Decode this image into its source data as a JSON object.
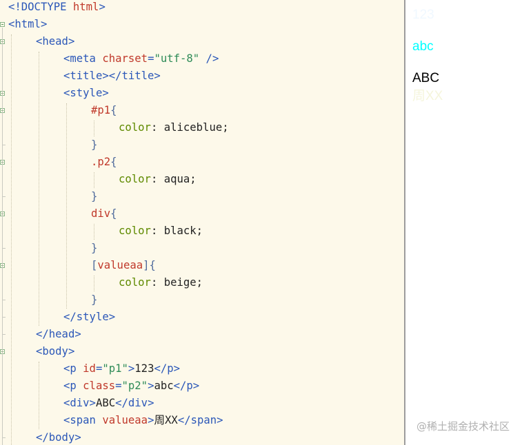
{
  "editor": {
    "lines": [
      {
        "indent": 0,
        "fold": "none",
        "tokens": [
          {
            "c": "t",
            "t": "<!DOCTYPE "
          },
          {
            "c": "a",
            "t": "html"
          },
          {
            "c": "t",
            "t": ">"
          }
        ]
      },
      {
        "indent": 0,
        "fold": "open",
        "tokens": [
          {
            "c": "t",
            "t": "<html>"
          }
        ]
      },
      {
        "indent": 1,
        "fold": "open",
        "tokens": [
          {
            "c": "t",
            "t": "<head>"
          }
        ]
      },
      {
        "indent": 2,
        "fold": "none",
        "tokens": [
          {
            "c": "t",
            "t": "<meta "
          },
          {
            "c": "a",
            "t": "charset"
          },
          {
            "c": "t",
            "t": "="
          },
          {
            "c": "v",
            "t": "\"utf-8\""
          },
          {
            "c": "t",
            "t": " />"
          }
        ]
      },
      {
        "indent": 2,
        "fold": "none",
        "tokens": [
          {
            "c": "t",
            "t": "<title></title>"
          }
        ]
      },
      {
        "indent": 2,
        "fold": "open",
        "tokens": [
          {
            "c": "t",
            "t": "<style>"
          }
        ]
      },
      {
        "indent": 3,
        "fold": "open",
        "tokens": [
          {
            "c": "sel",
            "t": "#p1"
          },
          {
            "c": "br",
            "t": "{"
          }
        ]
      },
      {
        "indent": 4,
        "fold": "none",
        "tokens": [
          {
            "c": "pr",
            "t": "color"
          },
          {
            "c": "pv",
            "t": ": aliceblue;"
          }
        ]
      },
      {
        "indent": 3,
        "fold": "end",
        "tokens": [
          {
            "c": "br",
            "t": "}"
          }
        ]
      },
      {
        "indent": 3,
        "fold": "open",
        "tokens": [
          {
            "c": "sel",
            "t": ".p2"
          },
          {
            "c": "br",
            "t": "{"
          }
        ]
      },
      {
        "indent": 4,
        "fold": "none",
        "tokens": [
          {
            "c": "pr",
            "t": "color"
          },
          {
            "c": "pv",
            "t": ": aqua;"
          }
        ]
      },
      {
        "indent": 3,
        "fold": "end",
        "tokens": [
          {
            "c": "br",
            "t": "}"
          }
        ]
      },
      {
        "indent": 3,
        "fold": "open",
        "tokens": [
          {
            "c": "tn",
            "t": "div"
          },
          {
            "c": "br",
            "t": "{"
          }
        ]
      },
      {
        "indent": 4,
        "fold": "none",
        "tokens": [
          {
            "c": "pr",
            "t": "color"
          },
          {
            "c": "pv",
            "t": ": black;"
          }
        ]
      },
      {
        "indent": 3,
        "fold": "end",
        "tokens": [
          {
            "c": "br",
            "t": "}"
          }
        ]
      },
      {
        "indent": 3,
        "fold": "open",
        "tokens": [
          {
            "c": "br",
            "t": "["
          },
          {
            "c": "sel",
            "t": "valueaa"
          },
          {
            "c": "br",
            "t": "]{"
          }
        ]
      },
      {
        "indent": 4,
        "fold": "none",
        "tokens": [
          {
            "c": "pr",
            "t": "color"
          },
          {
            "c": "pv",
            "t": ": beige;"
          }
        ]
      },
      {
        "indent": 3,
        "fold": "end",
        "tokens": [
          {
            "c": "br",
            "t": "}"
          }
        ]
      },
      {
        "indent": 2,
        "fold": "end",
        "tokens": [
          {
            "c": "t",
            "t": "</style>"
          }
        ]
      },
      {
        "indent": 1,
        "fold": "end",
        "tokens": [
          {
            "c": "t",
            "t": "</head>"
          }
        ]
      },
      {
        "indent": 1,
        "fold": "open",
        "tokens": [
          {
            "c": "t",
            "t": "<body>"
          }
        ]
      },
      {
        "indent": 2,
        "fold": "none",
        "tokens": [
          {
            "c": "t",
            "t": "<p "
          },
          {
            "c": "a",
            "t": "id"
          },
          {
            "c": "t",
            "t": "="
          },
          {
            "c": "v",
            "t": "\"p1\""
          },
          {
            "c": "t",
            "t": ">"
          },
          {
            "c": "tx",
            "t": "123"
          },
          {
            "c": "t",
            "t": "</p>"
          }
        ]
      },
      {
        "indent": 2,
        "fold": "none",
        "tokens": [
          {
            "c": "t",
            "t": "<p "
          },
          {
            "c": "a",
            "t": "class"
          },
          {
            "c": "t",
            "t": "="
          },
          {
            "c": "v",
            "t": "\"p2\""
          },
          {
            "c": "t",
            "t": ">"
          },
          {
            "c": "tx",
            "t": "abc"
          },
          {
            "c": "t",
            "t": "</p>"
          }
        ]
      },
      {
        "indent": 2,
        "fold": "none",
        "tokens": [
          {
            "c": "t",
            "t": "<div>"
          },
          {
            "c": "tx",
            "t": "ABC"
          },
          {
            "c": "t",
            "t": "</div>"
          }
        ]
      },
      {
        "indent": 2,
        "fold": "none",
        "tokens": [
          {
            "c": "t",
            "t": "<span "
          },
          {
            "c": "a",
            "t": "valueaa"
          },
          {
            "c": "t",
            "t": ">"
          },
          {
            "c": "tx",
            "t": "周XX"
          },
          {
            "c": "t",
            "t": "</span>"
          }
        ]
      },
      {
        "indent": 1,
        "fold": "end",
        "tokens": [
          {
            "c": "t",
            "t": "</body>"
          }
        ]
      }
    ]
  },
  "preview": {
    "items": [
      {
        "name": "preview-p1",
        "text": "123",
        "color": "#f0f8ff"
      },
      {
        "name": "preview-p2",
        "text": "abc",
        "color": "#00ffff"
      },
      {
        "name": "preview-div",
        "text": "ABC",
        "color": "#000000"
      },
      {
        "name": "preview-span",
        "text": "周XX",
        "color": "#f5f5dc"
      }
    ]
  },
  "watermark": "@稀土掘金技术社区"
}
